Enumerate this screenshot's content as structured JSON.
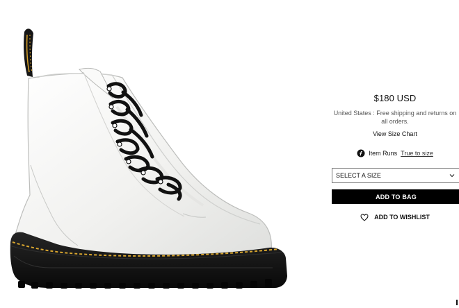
{
  "product": {
    "image_alt": "White leather platform boot"
  },
  "details": {
    "price": "$180 USD",
    "shipping": "United States : Free shipping and returns on all orders.",
    "size_chart": "View Size Chart",
    "fit_label": "Item Runs",
    "fit_value": "True to size",
    "size_select": "SELECT A SIZE",
    "add_to_bag": "ADD TO BAG",
    "add_to_wishlist": "ADD TO WISHLIST"
  },
  "icons": {
    "fit": "fit-icon",
    "chevron": "chevron-down-icon",
    "wishlist": "heart-icon"
  },
  "colors": {
    "button_background": "#000000",
    "button_text": "#ffffff",
    "boot_white": "#f1f1f0",
    "stitching": "#d9a62f",
    "sole": "#151515"
  }
}
